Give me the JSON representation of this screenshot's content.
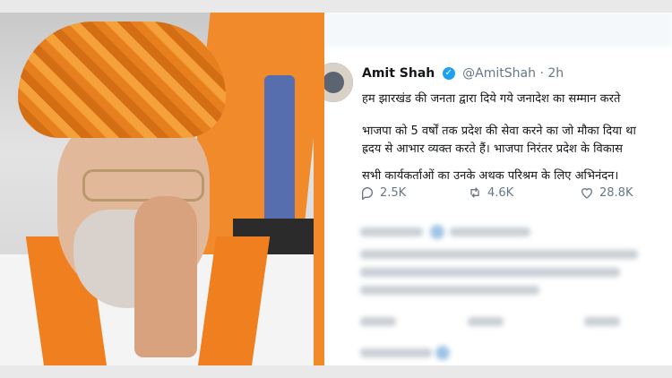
{
  "tweet": {
    "name": "Amit Shah",
    "handle": "@AmitShah",
    "time": "2h",
    "lines": [
      "हम झारखंड की जनता द्वारा दिये गये जनादेश का सम्मान करते",
      "भाजपा को 5 वर्षों तक प्रदेश की सेवा करने का जो मौका दिया था",
      "ह्रदय से आभार व्यक्त करते हैं। भाजपा निरंतर प्रदेश के विकास",
      "सभी कार्यकर्ताओं का उनके अथक परिश्रम के लिए अभिनंदन।"
    ],
    "replies": "2.5K",
    "retweets": "4.6K",
    "likes": "28.8K"
  },
  "icons": {
    "verified": "verified-badge-icon",
    "reply": "reply-icon",
    "retweet": "retweet-icon",
    "like": "like-icon"
  },
  "colors": {
    "accent_orange": "#f28a2a",
    "twitter_blue": "#1da1f2",
    "action_gray": "#657786"
  }
}
